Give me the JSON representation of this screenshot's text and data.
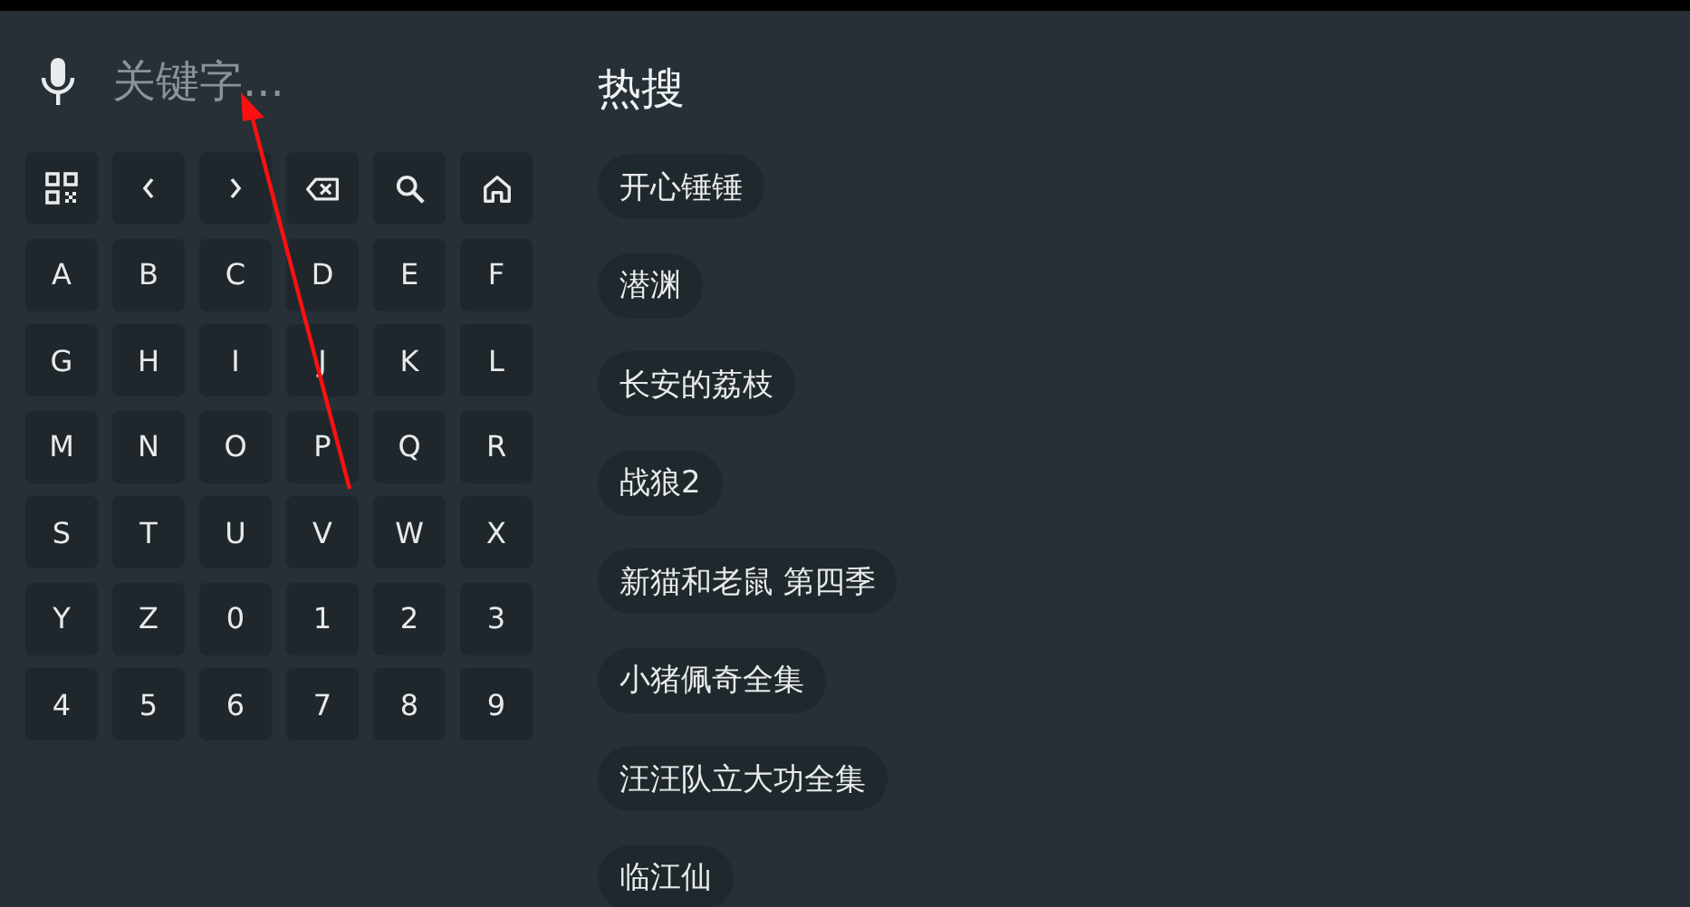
{
  "search": {
    "placeholder": "关键字..."
  },
  "function_keys": [
    {
      "kind": "qr"
    },
    {
      "kind": "left"
    },
    {
      "kind": "right"
    },
    {
      "kind": "backspace"
    },
    {
      "kind": "search"
    },
    {
      "kind": "home"
    }
  ],
  "keys": [
    "A",
    "B",
    "C",
    "D",
    "E",
    "F",
    "G",
    "H",
    "I",
    "J",
    "K",
    "L",
    "M",
    "N",
    "O",
    "P",
    "Q",
    "R",
    "S",
    "T",
    "U",
    "V",
    "W",
    "X",
    "Y",
    "Z",
    "0",
    "1",
    "2",
    "3",
    "4",
    "5",
    "6",
    "7",
    "8",
    "9"
  ],
  "hot_search": {
    "title": "热搜",
    "items": [
      "开心锤锤",
      "潜渊",
      "长安的荔枝",
      "战狼2",
      "新猫和老鼠 第四季",
      "小猪佩奇全集",
      "汪汪队立大功全集",
      "临江仙"
    ]
  }
}
